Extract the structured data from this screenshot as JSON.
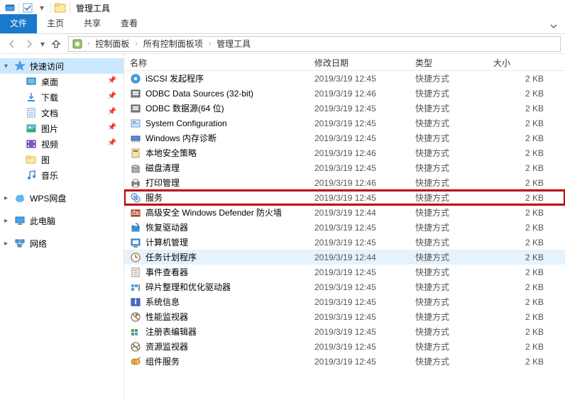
{
  "titlebar": {
    "title": "管理工具"
  },
  "ribbon": {
    "file": "文件",
    "home": "主页",
    "share": "共享",
    "view": "查看"
  },
  "breadcrumb": {
    "items": [
      "控制面板",
      "所有控制面板项",
      "管理工具"
    ]
  },
  "columns": {
    "name": "名称",
    "date": "修改日期",
    "type": "类型",
    "size": "大小"
  },
  "sidebar": {
    "quick_access": "快速访问",
    "items": [
      {
        "label": "桌面",
        "pinned": true,
        "icon": "desktop"
      },
      {
        "label": "下载",
        "pinned": true,
        "icon": "download"
      },
      {
        "label": "文档",
        "pinned": true,
        "icon": "document"
      },
      {
        "label": "图片",
        "pinned": true,
        "icon": "picture"
      },
      {
        "label": "视频",
        "pinned": true,
        "icon": "video"
      },
      {
        "label": "图",
        "pinned": false,
        "icon": "folder"
      },
      {
        "label": "音乐",
        "pinned": false,
        "icon": "music"
      }
    ],
    "wps": "WPS网盘",
    "this_pc": "此电脑",
    "network": "网络"
  },
  "rows": [
    {
      "name": "iSCSI 发起程序",
      "date": "2019/3/19 12:45",
      "type": "快捷方式",
      "size": "2 KB",
      "icon": "iscsi"
    },
    {
      "name": "ODBC Data Sources (32-bit)",
      "date": "2019/3/19 12:46",
      "type": "快捷方式",
      "size": "2 KB",
      "icon": "odbc"
    },
    {
      "name": "ODBC 数据源(64 位)",
      "date": "2019/3/19 12:45",
      "type": "快捷方式",
      "size": "2 KB",
      "icon": "odbc"
    },
    {
      "name": "System Configuration",
      "date": "2019/3/19 12:45",
      "type": "快捷方式",
      "size": "2 KB",
      "icon": "sysconfig"
    },
    {
      "name": "Windows 内存诊断",
      "date": "2019/3/19 12:45",
      "type": "快捷方式",
      "size": "2 KB",
      "icon": "memory"
    },
    {
      "name": "本地安全策略",
      "date": "2019/3/19 12:46",
      "type": "快捷方式",
      "size": "2 KB",
      "icon": "security"
    },
    {
      "name": "磁盘清理",
      "date": "2019/3/19 12:45",
      "type": "快捷方式",
      "size": "2 KB",
      "icon": "cleanup"
    },
    {
      "name": "打印管理",
      "date": "2019/3/19 12:46",
      "type": "快捷方式",
      "size": "2 KB",
      "icon": "print"
    },
    {
      "name": "服务",
      "date": "2019/3/19 12:45",
      "type": "快捷方式",
      "size": "2 KB",
      "icon": "services",
      "highlighted": true
    },
    {
      "name": "高级安全 Windows Defender 防火墙",
      "date": "2019/3/19 12:44",
      "type": "快捷方式",
      "size": "2 KB",
      "icon": "firewall"
    },
    {
      "name": "恢复驱动器",
      "date": "2019/3/19 12:45",
      "type": "快捷方式",
      "size": "2 KB",
      "icon": "recovery"
    },
    {
      "name": "计算机管理",
      "date": "2019/3/19 12:45",
      "type": "快捷方式",
      "size": "2 KB",
      "icon": "compmgmt"
    },
    {
      "name": "任务计划程序",
      "date": "2019/3/19 12:44",
      "type": "快捷方式",
      "size": "2 KB",
      "icon": "scheduler",
      "selected": true
    },
    {
      "name": "事件查看器",
      "date": "2019/3/19 12:45",
      "type": "快捷方式",
      "size": "2 KB",
      "icon": "eventviewer"
    },
    {
      "name": "碎片整理和优化驱动器",
      "date": "2019/3/19 12:45",
      "type": "快捷方式",
      "size": "2 KB",
      "icon": "defrag"
    },
    {
      "name": "系统信息",
      "date": "2019/3/19 12:45",
      "type": "快捷方式",
      "size": "2 KB",
      "icon": "sysinfo"
    },
    {
      "name": "性能监视器",
      "date": "2019/3/19 12:45",
      "type": "快捷方式",
      "size": "2 KB",
      "icon": "perfmon"
    },
    {
      "name": "注册表编辑器",
      "date": "2019/3/19 12:45",
      "type": "快捷方式",
      "size": "2 KB",
      "icon": "regedit"
    },
    {
      "name": "资源监视器",
      "date": "2019/3/19 12:45",
      "type": "快捷方式",
      "size": "2 KB",
      "icon": "resmon"
    },
    {
      "name": "组件服务",
      "date": "2019/3/19 12:45",
      "type": "快捷方式",
      "size": "2 KB",
      "icon": "compsvc"
    }
  ]
}
